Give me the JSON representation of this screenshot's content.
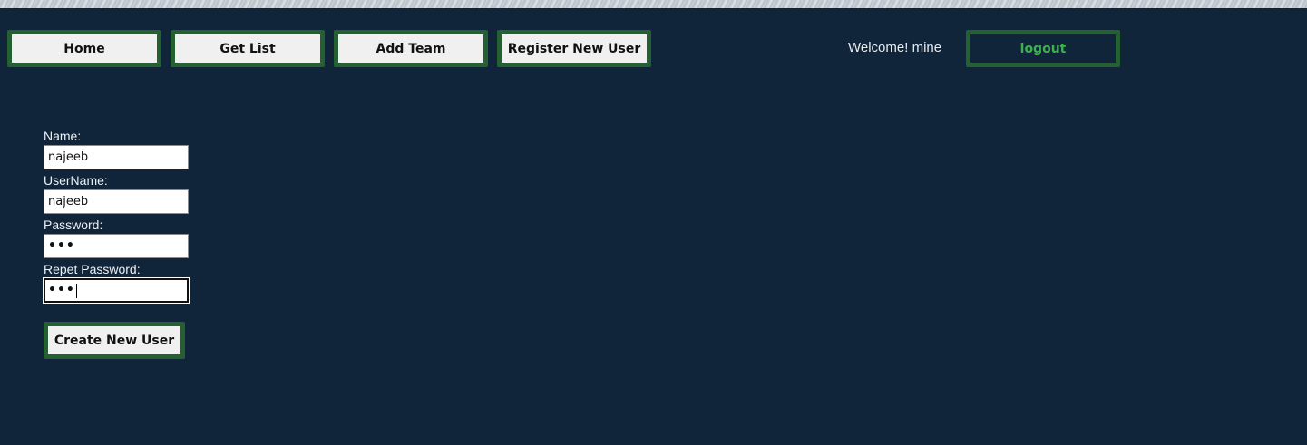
{
  "nav": {
    "items": [
      {
        "label": "Home"
      },
      {
        "label": "Get List"
      },
      {
        "label": "Add Team"
      },
      {
        "label": "Register New User"
      }
    ]
  },
  "header": {
    "welcome_text": "Welcome! mine",
    "logout_label": "logout"
  },
  "form": {
    "name_label": "Name:",
    "name_value": "najeeb",
    "username_label": "UserName:",
    "username_value": "najeeb",
    "password_label": "Password:",
    "password_value": "•••",
    "repeat_password_label": "Repet Password:",
    "repeat_password_value": "•••",
    "submit_label": "Create New User"
  },
  "colors": {
    "background": "#10243a",
    "button_border": "#246032",
    "logout_text": "#3db24f"
  }
}
